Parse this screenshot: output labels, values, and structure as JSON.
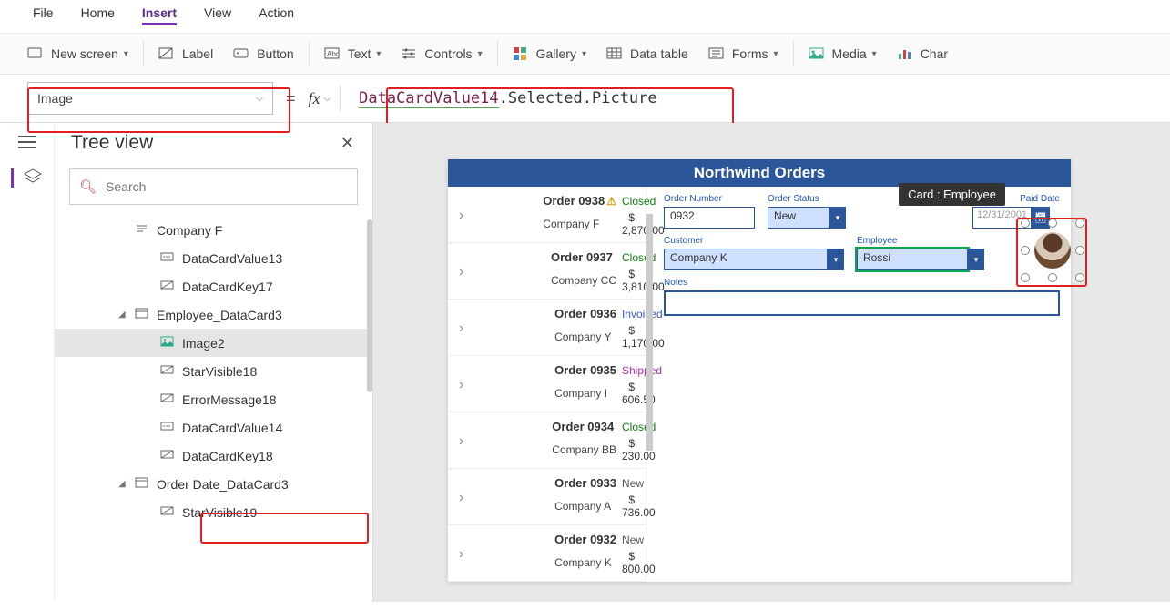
{
  "menubar": [
    "File",
    "Home",
    "Insert",
    "View",
    "Action"
  ],
  "menubar_active": 2,
  "ribbon": {
    "new_screen": "New screen",
    "label": "Label",
    "button": "Button",
    "text": "Text",
    "controls": "Controls",
    "gallery": "Gallery",
    "data_table": "Data table",
    "forms": "Forms",
    "media": "Media",
    "chart": "Char"
  },
  "property_dropdown": "Image",
  "formula": {
    "token_var": "DataCardValue14",
    "token_rest": ".Selected.Picture"
  },
  "tree_panel": {
    "title": "Tree view",
    "search_placeholder": "Search"
  },
  "tree": [
    {
      "indent": 3,
      "icon": "txt",
      "label": "Company F"
    },
    {
      "indent": 4,
      "icon": "input",
      "label": "DataCardValue13"
    },
    {
      "indent": 4,
      "icon": "key",
      "label": "DataCardKey17"
    },
    {
      "indent": 3,
      "icon": "card",
      "label": "Employee_DataCard3",
      "expanded": true
    },
    {
      "indent": 4,
      "icon": "img",
      "label": "Image2",
      "selected": true
    },
    {
      "indent": 4,
      "icon": "key",
      "label": "StarVisible18"
    },
    {
      "indent": 4,
      "icon": "key",
      "label": "ErrorMessage18"
    },
    {
      "indent": 4,
      "icon": "input",
      "label": "DataCardValue14"
    },
    {
      "indent": 4,
      "icon": "key",
      "label": "DataCardKey18"
    },
    {
      "indent": 3,
      "icon": "card",
      "label": "Order Date_DataCard3",
      "expanded": true
    },
    {
      "indent": 4,
      "icon": "key",
      "label": "StarVisible19"
    }
  ],
  "app": {
    "title": "Northwind Orders",
    "orders": [
      {
        "num": "Order 0938",
        "warn": true,
        "status": "Closed",
        "status_cls": "st-closed",
        "company": "Company F",
        "amount": "$ 2,870.00"
      },
      {
        "num": "Order 0937",
        "status": "Closed",
        "status_cls": "st-closed",
        "company": "Company CC",
        "amount": "$ 3,810.00"
      },
      {
        "num": "Order 0936",
        "status": "Invoiced",
        "status_cls": "st-inv",
        "company": "Company Y",
        "amount": "$ 1,170.00"
      },
      {
        "num": "Order 0935",
        "status": "Shipped",
        "status_cls": "st-ship",
        "company": "Company I",
        "amount": "$ 606.50"
      },
      {
        "num": "Order 0934",
        "status": "Closed",
        "status_cls": "st-closed",
        "company": "Company BB",
        "amount": "$ 230.00"
      },
      {
        "num": "Order 0933",
        "status": "New",
        "status_cls": "st-new",
        "company": "Company A",
        "amount": "$ 736.00"
      },
      {
        "num": "Order 0932",
        "status": "New",
        "status_cls": "st-new",
        "company": "Company K",
        "amount": "$ 800.00"
      }
    ],
    "form": {
      "labels": {
        "order_number": "Order Number",
        "order_status": "Order Status",
        "paid_date": "Paid Date",
        "customer": "Customer",
        "employee": "Employee",
        "notes": "Notes"
      },
      "order_number": "0932",
      "order_status": "New",
      "paid_date": "12/31/2001",
      "customer": "Company K",
      "employee": "Rossi",
      "tooltip": "Card : Employee"
    }
  }
}
